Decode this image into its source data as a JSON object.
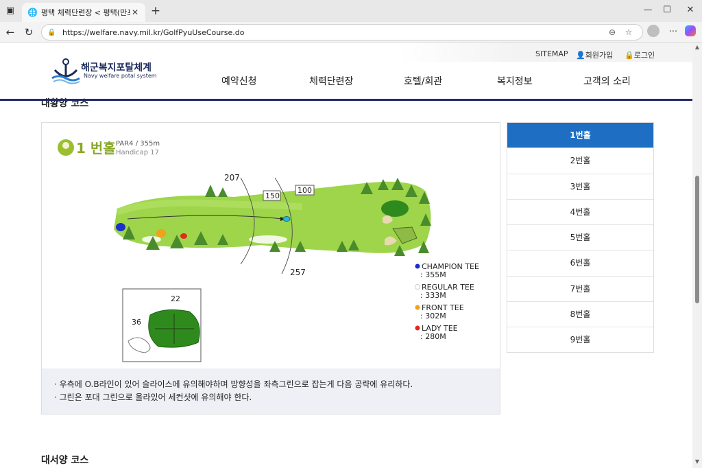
{
  "browser": {
    "tab_title": "평택 체력단련장 < 평택(만포대) 골",
    "url": "https://welfare.navy.mil.kr/GolfPyuUseCourse.do",
    "controls": {
      "minimize": "—",
      "maximize": "☐",
      "close": "✕",
      "new_tab": "+"
    }
  },
  "header": {
    "logo_title": "해군복지포탈체계",
    "logo_sub": "Navy welfare potal system",
    "util": {
      "sitemap": "SITEMAP",
      "join": "회원가입",
      "login": "로그인"
    },
    "menu": [
      "예약신청",
      "체력단련장",
      "호텔/회관",
      "복지정보",
      "고객의 소리"
    ]
  },
  "section_title_cut": "대황양 코스",
  "hole_info": {
    "number_label": "1 번홀",
    "par_line": "PAR4 / 355m",
    "handicap_line": "Handicap 17",
    "distances": {
      "top": "207",
      "bottom": "257",
      "marker_150": "150",
      "marker_100": "100"
    },
    "green_numbers": {
      "top": "22",
      "left": "36"
    },
    "tees": [
      {
        "name": "CHAMPION TEE",
        "dist": ": 355M",
        "color": "#1b2fc9"
      },
      {
        "name": "REGULAR TEE",
        "dist": ": 333M",
        "color": "#ffffff"
      },
      {
        "name": "FRONT TEE",
        "dist": ": 302M",
        "color": "#f0a21a"
      },
      {
        "name": "LADY TEE",
        "dist": ": 280M",
        "color": "#e02b1f"
      }
    ]
  },
  "notes": [
    "· 우측에 O.B라인이 있어 슬라이스에 유의해야하며 방향성을 좌측그린으로 잡는게 다음 공략에 유리하다.",
    "· 그린은 포대 그린으로 올라있어 세컨샷에 유의해야 한다."
  ],
  "holes": [
    "1번홀",
    "2번홀",
    "3번홀",
    "4번홀",
    "5번홀",
    "6번홀",
    "7번홀",
    "8번홀",
    "9번홀"
  ],
  "next_section": "대서양 코스",
  "colors": {
    "brand_navy": "#232b6c",
    "active_blue": "#1e6fc4",
    "fairway": "#9ed54a",
    "green": "#2f8a1e"
  }
}
